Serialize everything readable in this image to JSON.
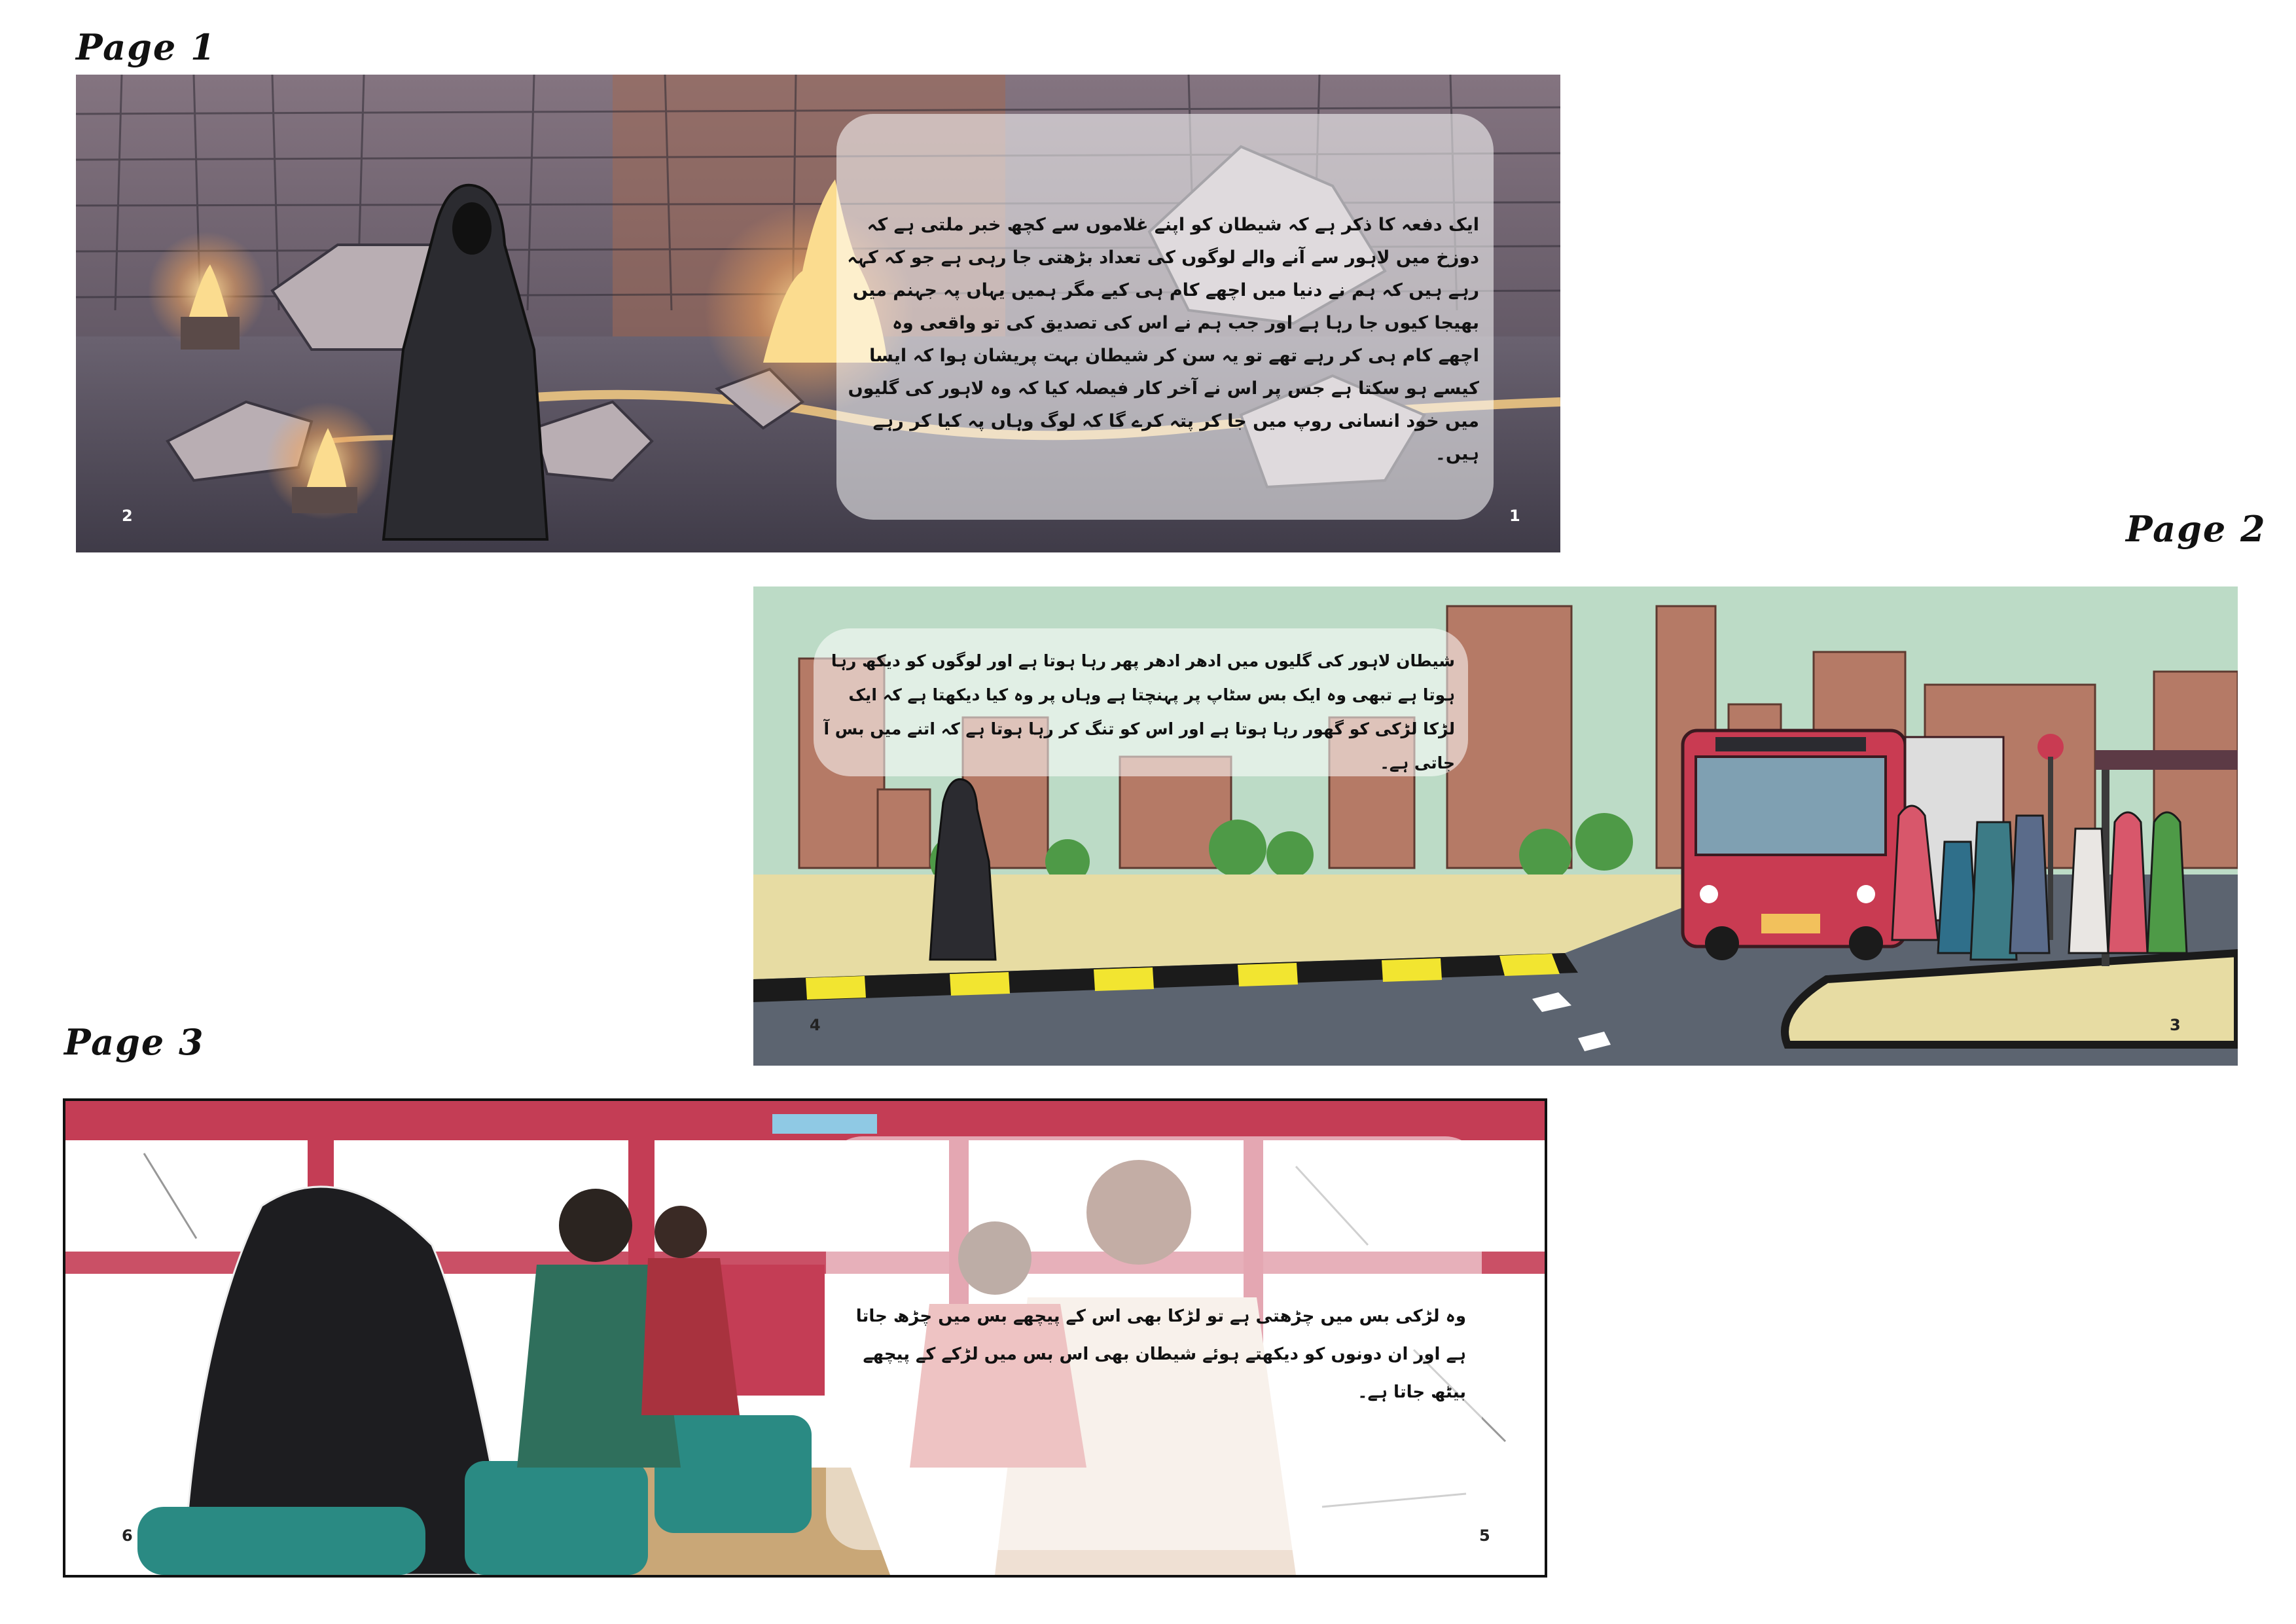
{
  "labels": {
    "page1": "Page 1",
    "page2": "Page 2",
    "page3": "Page 3"
  },
  "spread1": {
    "text": "ایک دفعہ کا ذکر ہے کہ شیطان کو اپنے غلاموں سے کچھ خبر ملتی ہے کہ دوزخ میں لاہور سے آنے والے لوگوں کی تعداد بڑھتی جا رہی ہے جو کہ کہہ رہے ہیں کہ ہم نے دنیا میں اچھے کام ہی کیے مگر ہمیں یہاں پہ جہنم میں بھیجا کیوں جا رہا ہے اور جب ہم نے اس کی تصدیق کی تو واقعی وہ اچھے کام ہی کر رہے تھے تو یہ سن کر شیطان بہت پریشان ہوا کہ ایسا کیسے ہو سکتا ہے جس پر اس نے آخر کار فیصلہ کیا کہ وہ لاہور کی گلیوں میں خود انسانی روپ میں جا کر پتہ کرے گا کہ لوگ وہاں پہ کیا کر رہے ہیں۔",
    "left_page_number": "2",
    "right_page_number": "1",
    "palette": {
      "wall": "#5d5560",
      "floor": "#6a6572",
      "fire": "#f4c066",
      "lava": "#f1c27a",
      "cloak": "#2b2b30"
    }
  },
  "spread2": {
    "text": "شیطان لاہور کی گلیوں میں ادھر ادھر پھر رہا ہوتا ہے اور لوگوں کو دیکھ رہا ہوتا ہے تبھی وہ ایک بس سٹاپ پر پہنچتا ہے وہاں پر وہ کیا دیکھتا ہے کہ ایک لڑکا لڑکی کو گھور رہا ہوتا ہے اور اس کو تنگ کر رہا ہوتا ہے کہ اتنے میں بس آ جاتی ہے۔",
    "left_page_number": "4",
    "right_page_number": "3",
    "palette": {
      "sky": "#bcdbc6",
      "building": "#b57a66",
      "ground": "#e7dca3",
      "road": "#5c6470",
      "bus": "#c93b52",
      "curb_yellow": "#f2e530",
      "tree": "#4e9a47"
    }
  },
  "spread3": {
    "text": "وہ لڑکی بس میں چڑھتی ہے تو لڑکا بھی اس کے پیچھے بس میں چڑھ جاتا ہے اور ان دونوں کو دیکھتے ہوئے شیطان بھی اس بس میں لڑکے کے پیچھے بیٹھ جاتا ہے۔",
    "left_page_number": "6",
    "right_page_number": "5",
    "palette": {
      "frame_red": "#c43d55",
      "seat_teal": "#2a8a83",
      "shirt_green": "#2f6f5c",
      "floor": "#c9a777"
    }
  }
}
